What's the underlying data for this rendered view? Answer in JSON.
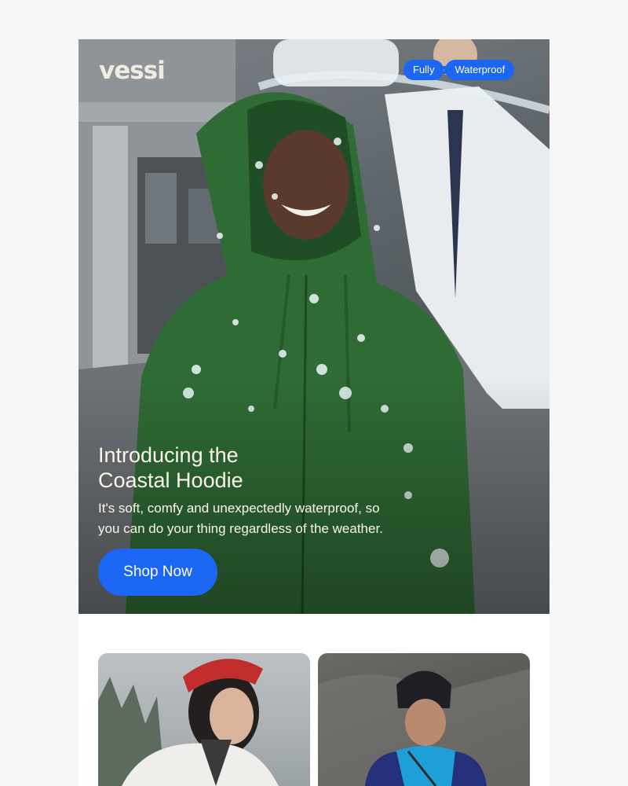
{
  "brand": {
    "logo_text": "vessi"
  },
  "badges": {
    "left": "Fully",
    "right": "Waterproof"
  },
  "hero": {
    "title_line1": "Introducing the",
    "title_line2": "Coastal Hoodie",
    "subtitle_line1": "It's soft, comfy and unexpectedly waterproof, so",
    "subtitle_line2": "you can do your thing regardless of the weather.",
    "cta_label": "Shop Now"
  },
  "colors": {
    "accent": "#1b66f2",
    "hoodie_green": "#2f6b35",
    "cream_text": "#fbf5ea"
  },
  "products": [
    {
      "image": "woman-in-red-bandana-white-jacket"
    },
    {
      "image": "man-in-beanie-blue-jacket"
    }
  ]
}
